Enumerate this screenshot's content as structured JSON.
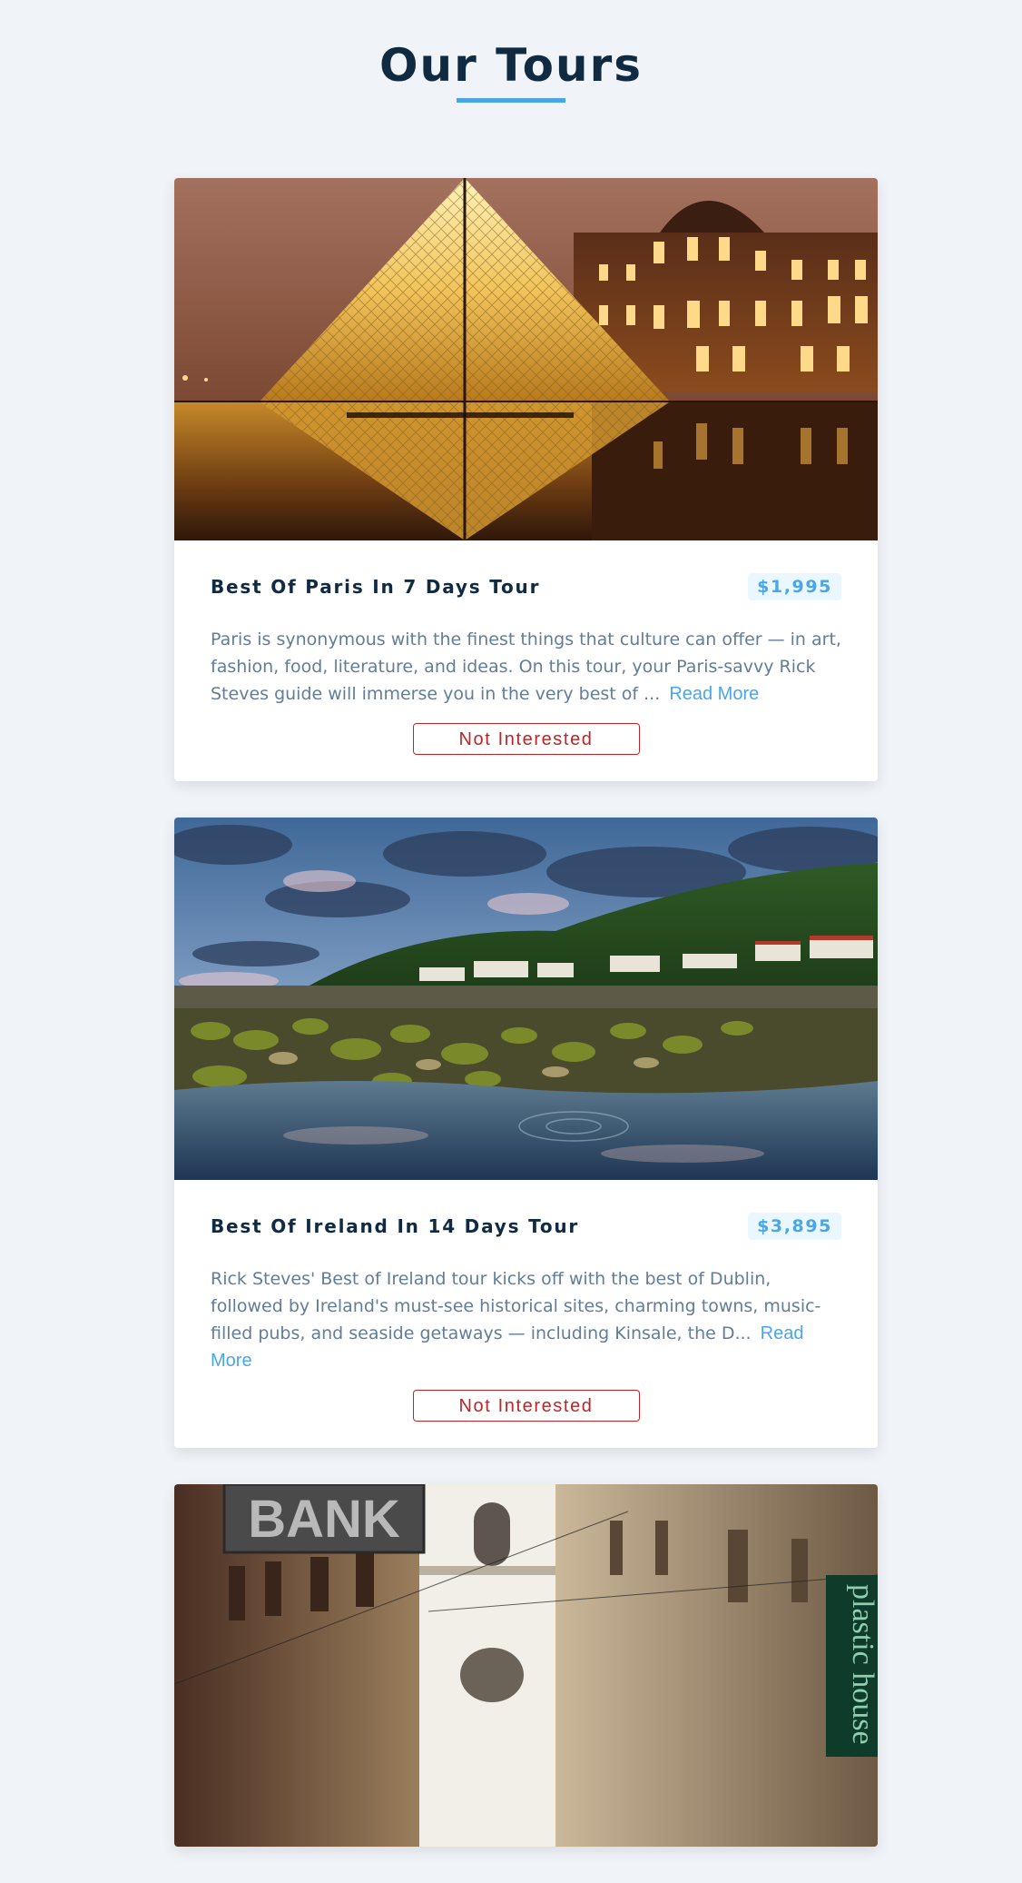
{
  "page": {
    "title": "Our Tours",
    "colors": {
      "background": "#f0f4f8",
      "accent": "#49a6e9",
      "title": "#102a42",
      "danger": "#bb2525",
      "text_muted": "#617d98"
    }
  },
  "tours": [
    {
      "name": "Best Of Paris In 7 Days Tour",
      "price": "$1,995",
      "description": "Paris is synonymous with the finest things that culture can offer — in art, fashion, food, literature, and ideas. On this tour, your Paris-savvy Rick Steves guide will immerse you in the very best of ...",
      "read_more": "Read More",
      "button": "Not Interested",
      "image": "louvre-pyramid-night-photo"
    },
    {
      "name": "Best Of Ireland In 14 Days Tour",
      "price": "$3,895",
      "description": "Rick Steves' Best of Ireland tour kicks off with the best of Dublin, followed by Ireland's must-see historical sites, charming towns, music-filled pubs, and seaside getaways — including Kinsale, the D...",
      "read_more": "Read More",
      "button": "Not Interested",
      "image": "irish-coast-rocks-photo"
    },
    {
      "image": "vienna-street-bank-sign-photo",
      "image_texts": {
        "bank_sign": "BANK",
        "shop_sign": "plastic house"
      }
    }
  ]
}
